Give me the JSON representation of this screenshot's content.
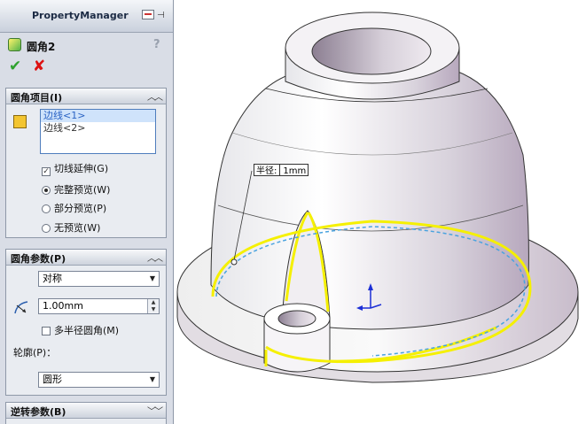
{
  "panel": {
    "title": "PropertyManager",
    "feature_name": "圆角2",
    "help_glyph": "?",
    "ok_glyph": "✔",
    "cancel_glyph": "✘"
  },
  "fillet_items": {
    "title": "圆角项目(I)",
    "edges": [
      "边线<1>",
      "边线<2>"
    ],
    "tangent_propagation": {
      "label": "切线延伸(G)",
      "checked": true
    },
    "preview": [
      {
        "label": "完整预览(W)",
        "selected": true
      },
      {
        "label": "部分预览(P)",
        "selected": false
      },
      {
        "label": "无预览(W)",
        "selected": false
      }
    ]
  },
  "fillet_params": {
    "title": "圆角参数(P)",
    "type_value": "对称",
    "radius_value": "1.00mm",
    "multi_radius": {
      "label": "多半径圆角(M)",
      "checked": false
    },
    "profile_label": "轮廓(P)：",
    "profile_value": "圆形"
  },
  "reverse_params": {
    "title": "逆转参数(B)"
  },
  "viewport": {
    "callout_label": "半径:",
    "callout_value": "1mm"
  },
  "colors": {
    "selection_highlight": "#f5f000",
    "preview_dash": "#4aa3df",
    "triad_blue": "#1c2fd6"
  },
  "icons": {
    "pin": "pin-icon",
    "feature": "fillet-feature-icon",
    "help": "help-icon",
    "collapse": "double-chevron-up-icon",
    "expand": "double-chevron-down-icon",
    "edges": "edge-selection-icon",
    "radius": "radius-icon"
  }
}
